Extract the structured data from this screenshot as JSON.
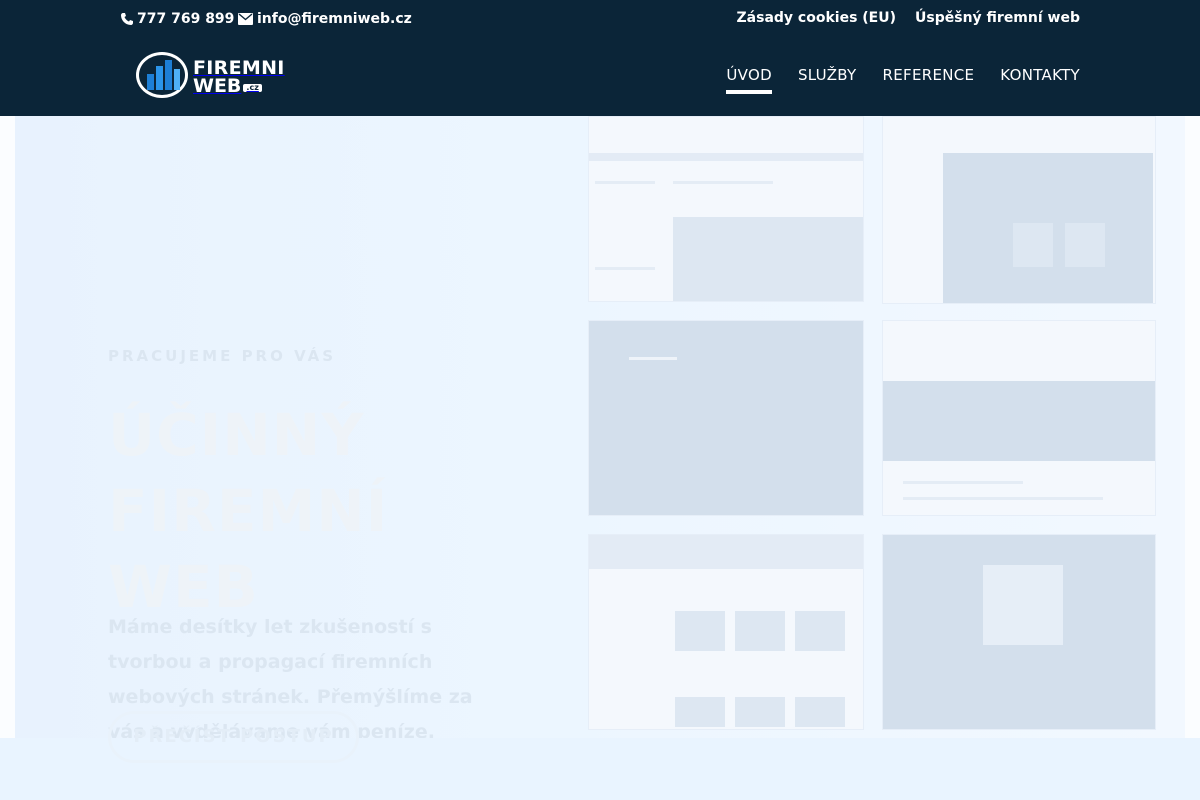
{
  "topbar": {
    "phone": "777 769 899",
    "email": "info@firemniweb.cz",
    "links": [
      "Zásady cookies (EU)",
      "Úspěšný firemní web"
    ],
    "icons": {
      "phone": "phone-icon",
      "email": "mail-icon"
    }
  },
  "logo": {
    "line1": "FIREMNI",
    "line2": "WEB",
    "suffix": ".cz"
  },
  "nav": [
    {
      "label": "ÚVOD",
      "active": true
    },
    {
      "label": "SLUŽBY",
      "active": false
    },
    {
      "label": "REFERENCE",
      "active": false
    },
    {
      "label": "KONTAKTY",
      "active": false
    }
  ],
  "hero": {
    "eyebrow": "PRACUJEME PRO VÁS",
    "headline": [
      "ÚČINNÝ",
      "FIREMNÍ",
      "WEB"
    ],
    "lead": "Máme desítky let zkušeností s tvorbou a propagací firemních webových stránek. Přemýšlíme za vás a vydělávame vám peníze.",
    "cta": "PŘEČÍST POSTUP"
  },
  "colors": {
    "header_bg": "#0b2538",
    "hero_bg": "#eaf4ff",
    "logo_blue": "#1d7fd6"
  }
}
